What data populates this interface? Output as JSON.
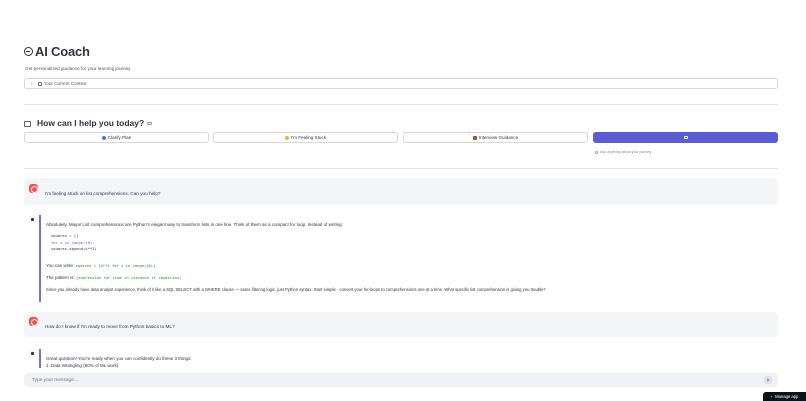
{
  "app": {
    "title": "AI Coach",
    "subtitle": "Get personalized guidance for your learning journey"
  },
  "context": {
    "label": "Your Current Context"
  },
  "help": {
    "title": "How can I help you today?"
  },
  "actions": [
    {
      "label": "Clarify Plan"
    },
    {
      "label": "I'm Feeling Stuck"
    },
    {
      "label": "Interview Guidance"
    },
    {
      "label": ""
    }
  ],
  "hint": "Ask anything about your journey",
  "messages": [
    {
      "role": "user",
      "text": "I'm feeling stuck on list comprehensions. Can you help?"
    },
    {
      "role": "assistant",
      "intro": "Absolutely, Maya! List comprehensions are Python's elegant way to transform lists in one line. Think of them as a compact for loop. Instead of writing:",
      "code": [
        "squares = []",
        "for x in range(10):",
        "    squares.append(x**2)"
      ],
      "write_prefix": "You can write:",
      "write_code": "squares = [x**2 for x in range(10)]",
      "pattern_prefix": "The pattern is:",
      "pattern_code": "[expression for item in iterable if condition]",
      "outro": "Since you already have data analyst experience, think of it like a SQL SELECT with a WHERE clause — same filtering logic, just Python syntax. Start simple - convert your for-loops to comprehensions one at a time. What specific list comprehension is giving you trouble?"
    },
    {
      "role": "user",
      "text": "How do I know if I'm ready to move from Python basics to ML?"
    },
    {
      "role": "assistant",
      "intro": "Great question! You're ready when you can confidently do these 3 things:",
      "item1": "1. Data Wrangling (90% of ML work)"
    }
  ],
  "input": {
    "placeholder": "Type your message..."
  },
  "footer": {
    "manage_label": "Manage app"
  }
}
